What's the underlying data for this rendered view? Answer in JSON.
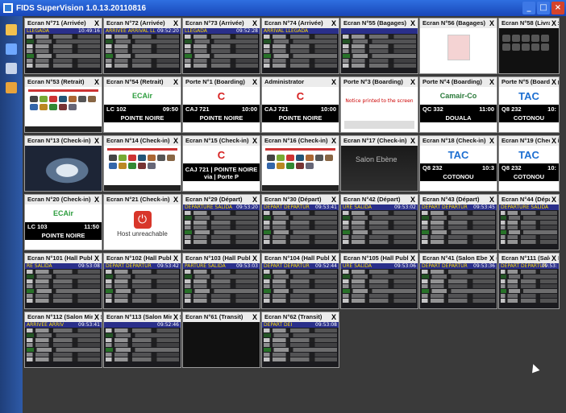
{
  "window": {
    "title": "FIDS SuperVision 1.0.13.20110816",
    "controls": [
      "minimize",
      "maximize",
      "close"
    ]
  },
  "toolbar": {
    "icons": [
      "folder-icon",
      "monitor-icon",
      "tools-icon",
      "pencil-icon"
    ]
  },
  "close_glyph": "X",
  "tiles": [
    {
      "title": "Ecran N°71 (Arrivée)",
      "kind": "board",
      "board_title": "LLEGADA",
      "board_time": "10:49:16"
    },
    {
      "title": "Ecran N°72 (Arrivée)",
      "kind": "board",
      "board_title": "ARRIVEE ARRIVAL LL",
      "board_time": "09:52:20"
    },
    {
      "title": "Ecran N°73 (Arrivée)",
      "kind": "board",
      "board_title": "LLEGADA",
      "board_time": "09:52:28"
    },
    {
      "title": "Ecran N°74 (Arrivée)",
      "kind": "board",
      "board_title": "ARRIVAL LLEGADA",
      "board_time": ""
    },
    {
      "title": "Ecran N°55 (Bagages)",
      "kind": "board",
      "board_title": "",
      "board_time": ""
    },
    {
      "title": "Ecran N°56 (Bagages)",
      "kind": "plain"
    },
    {
      "title": "Ecran N°58 (Livraison)",
      "kind": "dark"
    },
    {
      "title": "Ecran N°53 (Retrait)",
      "kind": "bags"
    },
    {
      "title": "Ecran N°54 (Retrait)",
      "kind": "brand",
      "logo": "ECAir",
      "flight": "LC 102",
      "time": "09:50",
      "dest": "POINTE NOIRE",
      "logo_color": "#2e9e3f"
    },
    {
      "title": "Porte N°1 (Boarding)",
      "kind": "brand",
      "logo": "C",
      "flight": "CAJ 721",
      "time": "10:00",
      "dest": "POINTE NOIRE",
      "logo_color": "#d62020"
    },
    {
      "title": "Administrator",
      "kind": "brand",
      "logo": "C",
      "flight": "CAJ 721",
      "time": "10:00",
      "dest": "POINTE NOIRE",
      "logo_color": "#d62020"
    },
    {
      "title": "Porte N°3 (Boarding)",
      "kind": "admin",
      "msg": "Notice printed to the screen"
    },
    {
      "title": "Porte N°4 (Boarding)",
      "kind": "brand",
      "logo": "Camair-Co",
      "flight": "QC 332",
      "time": "11:00",
      "dest": "DOUALA",
      "logo_color": "#2a7a3a"
    },
    {
      "title": "Porte N°5 (Boarding)",
      "kind": "brand",
      "logo": "TAC",
      "flight": "Q8 232",
      "time": "10:",
      "dest": "COTONOU",
      "logo_color": "#1d6fd1"
    },
    {
      "title": "Ecran N°13 (Check-in)",
      "kind": "radar"
    },
    {
      "title": "Ecran N°14 (Check-in)",
      "kind": "bags"
    },
    {
      "title": "Ecran N°15 (Check-in)",
      "kind": "brand",
      "logo": "C",
      "flight": "",
      "time": "",
      "dest": "CAJ 721 | POINTE NOIRE via | Porte P",
      "logo_color": "#d62020"
    },
    {
      "title": "Ecran N°16 (Check-in)",
      "kind": "bags"
    },
    {
      "title": "Ecran N°17 (Check-in)",
      "kind": "ebene",
      "text": "Salon Ebène"
    },
    {
      "title": "Ecran N°18 (Check-in)",
      "kind": "brand",
      "logo": "TAC",
      "flight": "Q8 232",
      "time": "10:3",
      "dest": "COTONOU",
      "logo_color": "#1d6fd1"
    },
    {
      "title": "Ecran N°19 (Check-in)",
      "kind": "brand",
      "logo": "TAC",
      "flight": "Q8 232",
      "time": "10:",
      "dest": "COTONOU",
      "logo_color": "#1d6fd1"
    },
    {
      "title": "Ecran N°20 (Check-in)",
      "kind": "brand",
      "logo": "ECAir",
      "flight": "LC 103",
      "time": "11:50",
      "dest": "POINTE NOIRE",
      "logo_color": "#2e9e3f"
    },
    {
      "title": "Ecran N°21 (Check-in)",
      "kind": "unreach",
      "msg": "Host unreachable"
    },
    {
      "title": "Ecran N°29 (Départ)",
      "kind": "board",
      "board_title": "DEPARTURE SALIDA",
      "board_time": "09:53:20"
    },
    {
      "title": "Ecran N°30 (Départ)",
      "kind": "board",
      "board_title": "DEPART DEPARTUR",
      "board_time": "09:53:41"
    },
    {
      "title": "Ecran N°42 (Départ)",
      "kind": "board",
      "board_title": "URE SALIDA",
      "board_time": "09:53:02"
    },
    {
      "title": "Ecran N°43 (Départ)",
      "kind": "board",
      "board_title": "DEPART DEPARTUR",
      "board_time": "09:53:45"
    },
    {
      "title": "Ecran N°44 (Départ)",
      "kind": "board",
      "board_title": "DEPARTURE SALIDA",
      "board_time": ""
    },
    {
      "title": "Ecran N°101 (Hall Public - C",
      "kind": "board",
      "board_title": "RE SALIDA",
      "board_time": "09:53:08"
    },
    {
      "title": "Ecran N°102 (Hall Public - C",
      "kind": "board",
      "board_title": "DEPART DEPARTUR",
      "board_time": "09:53:42"
    },
    {
      "title": "Ecran N°103 (Hall Public - C",
      "kind": "board",
      "board_title": "PARTURE SALIDA",
      "board_time": "09:53:03"
    },
    {
      "title": "Ecran N°104 (Hall Public - C",
      "kind": "board",
      "board_title": "DEPART DEPARTUR",
      "board_time": "09:52:44"
    },
    {
      "title": "Ecran N°105 (Hall Public - C",
      "kind": "board",
      "board_title": "URE SALIDA",
      "board_time": "09:53:06"
    },
    {
      "title": "Ecran N°41 (Salon Ebene)",
      "kind": "board",
      "board_title": "DEPART DEPARTUR",
      "board_time": "09:53:36"
    },
    {
      "title": "Ecran N°111 (Salon Ministe",
      "kind": "board",
      "board_title": "DEPART DEPARTUR",
      "board_time": "09:53:"
    },
    {
      "title": "Ecran N°112 (Salon Ministe",
      "kind": "board",
      "board_title": "ARRIVEE ARRIV",
      "board_time": "09:53:41"
    },
    {
      "title": "Ecran N°113 (Salon Ministe",
      "kind": "board",
      "board_title": "",
      "board_time": "09:52:46"
    },
    {
      "title": "Ecran N°61 (Transit)",
      "kind": "dark"
    },
    {
      "title": "Ecran N°62 (Transit)",
      "kind": "board",
      "board_title": "DEPART DEI",
      "board_time": "09:53:08"
    }
  ]
}
